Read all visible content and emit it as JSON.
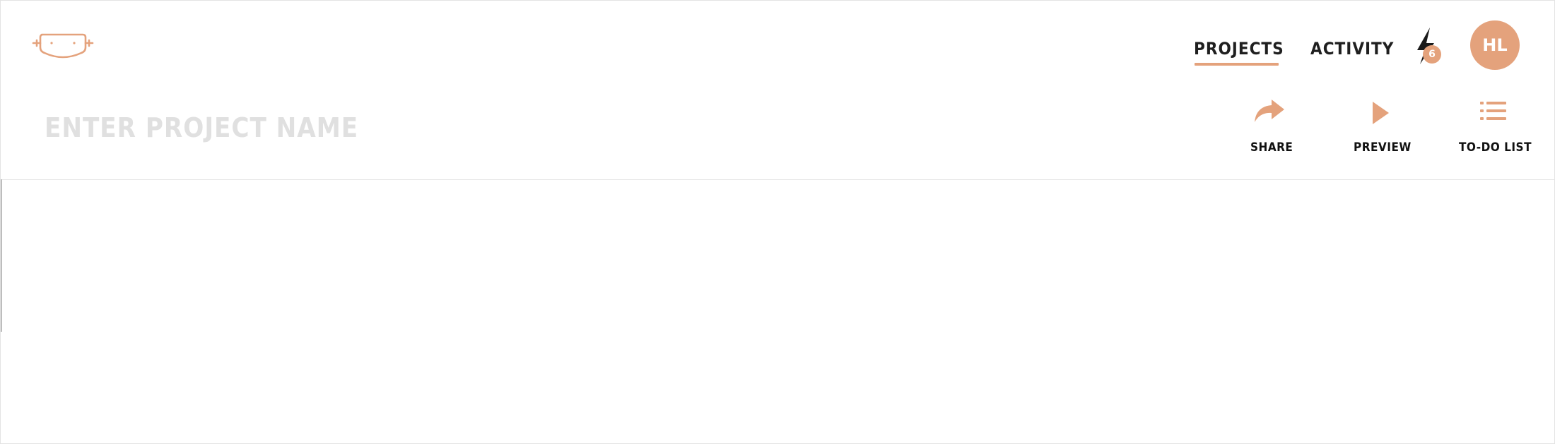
{
  "nav": {
    "items": [
      {
        "label": "PROJECTS",
        "active": true
      },
      {
        "label": "ACTIVITY",
        "active": false
      }
    ]
  },
  "notifications": {
    "icon": "lightning-bolt-icon",
    "count": "6"
  },
  "user": {
    "initials": "HL"
  },
  "project": {
    "name_value": "",
    "name_placeholder": "ENTER PROJECT NAME"
  },
  "toolbar": {
    "share_label": "SHARE",
    "preview_label": "PREVIEW",
    "todo_label": "TO-DO LIST"
  },
  "colors": {
    "accent": "#e4a27c",
    "text": "#1f1f1f",
    "placeholder": "#e0e0e0"
  }
}
